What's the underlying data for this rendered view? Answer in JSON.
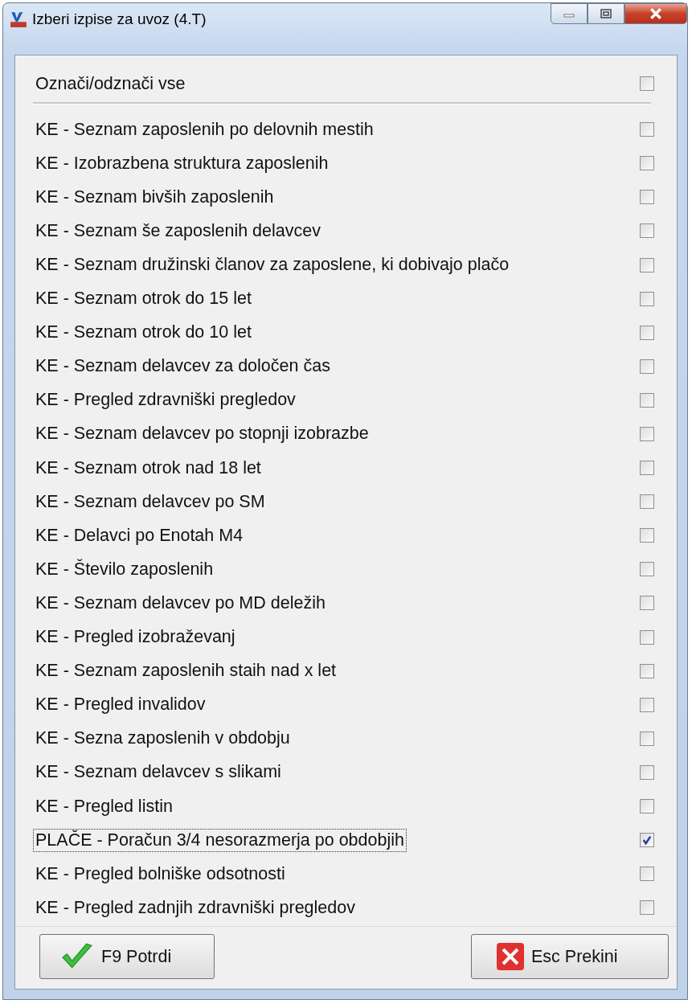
{
  "window": {
    "title": "Izberi izpise za uvoz  (4.T)"
  },
  "select_all": {
    "label": "Označi/odznači vse",
    "checked": false
  },
  "items": [
    {
      "label": "KE - Seznam zaposlenih po delovnih mestih",
      "checked": false,
      "focused": false
    },
    {
      "label": "KE - Izobrazbena struktura zaposlenih",
      "checked": false,
      "focused": false
    },
    {
      "label": "KE - Seznam bivših zaposlenih",
      "checked": false,
      "focused": false
    },
    {
      "label": "KE - Seznam še zaposlenih delavcev",
      "checked": false,
      "focused": false
    },
    {
      "label": "KE - Seznam družinski članov za zaposlene, ki dobivajo plačo",
      "checked": false,
      "focused": false
    },
    {
      "label": "KE - Seznam otrok do 15 let",
      "checked": false,
      "focused": false
    },
    {
      "label": "KE - Seznam otrok do 10 let",
      "checked": false,
      "focused": false
    },
    {
      "label": "KE - Seznam delavcev za določen čas",
      "checked": false,
      "focused": false
    },
    {
      "label": "KE - Pregled zdravniški pregledov",
      "checked": false,
      "focused": false
    },
    {
      "label": "KE - Seznam delavcev po stopnji izobrazbe",
      "checked": false,
      "focused": false
    },
    {
      "label": "KE - Seznam otrok nad 18 let",
      "checked": false,
      "focused": false
    },
    {
      "label": "KE - Seznam delavcev po SM",
      "checked": false,
      "focused": false
    },
    {
      "label": "KE - Delavci po Enotah M4",
      "checked": false,
      "focused": false
    },
    {
      "label": "KE - Število zaposlenih",
      "checked": false,
      "focused": false
    },
    {
      "label": "KE - Seznam delavcev po MD deležih",
      "checked": false,
      "focused": false
    },
    {
      "label": "KE - Pregled izobraževanj",
      "checked": false,
      "focused": false
    },
    {
      "label": "KE - Seznam zaposlenih staih nad x let",
      "checked": false,
      "focused": false
    },
    {
      "label": "KE - Pregled invalidov",
      "checked": false,
      "focused": false
    },
    {
      "label": "KE - Sezna zaposlenih v obdobju",
      "checked": false,
      "focused": false
    },
    {
      "label": "KE - Seznam delavcev s slikami",
      "checked": false,
      "focused": false
    },
    {
      "label": "KE - Pregled listin",
      "checked": false,
      "focused": false
    },
    {
      "label": "PLAČE - Poračun 3/4 nesorazmerja po obdobjih",
      "checked": true,
      "focused": true
    },
    {
      "label": "KE - Pregled bolniške odsotnosti",
      "checked": false,
      "focused": false
    },
    {
      "label": "KE - Pregled zadnjih zdravniški pregledov",
      "checked": false,
      "focused": false
    }
  ],
  "buttons": [
    {
      "label": "F9 Potrdi",
      "kind": "confirm"
    },
    {
      "label": "Esc Prekini",
      "kind": "cancel"
    }
  ]
}
